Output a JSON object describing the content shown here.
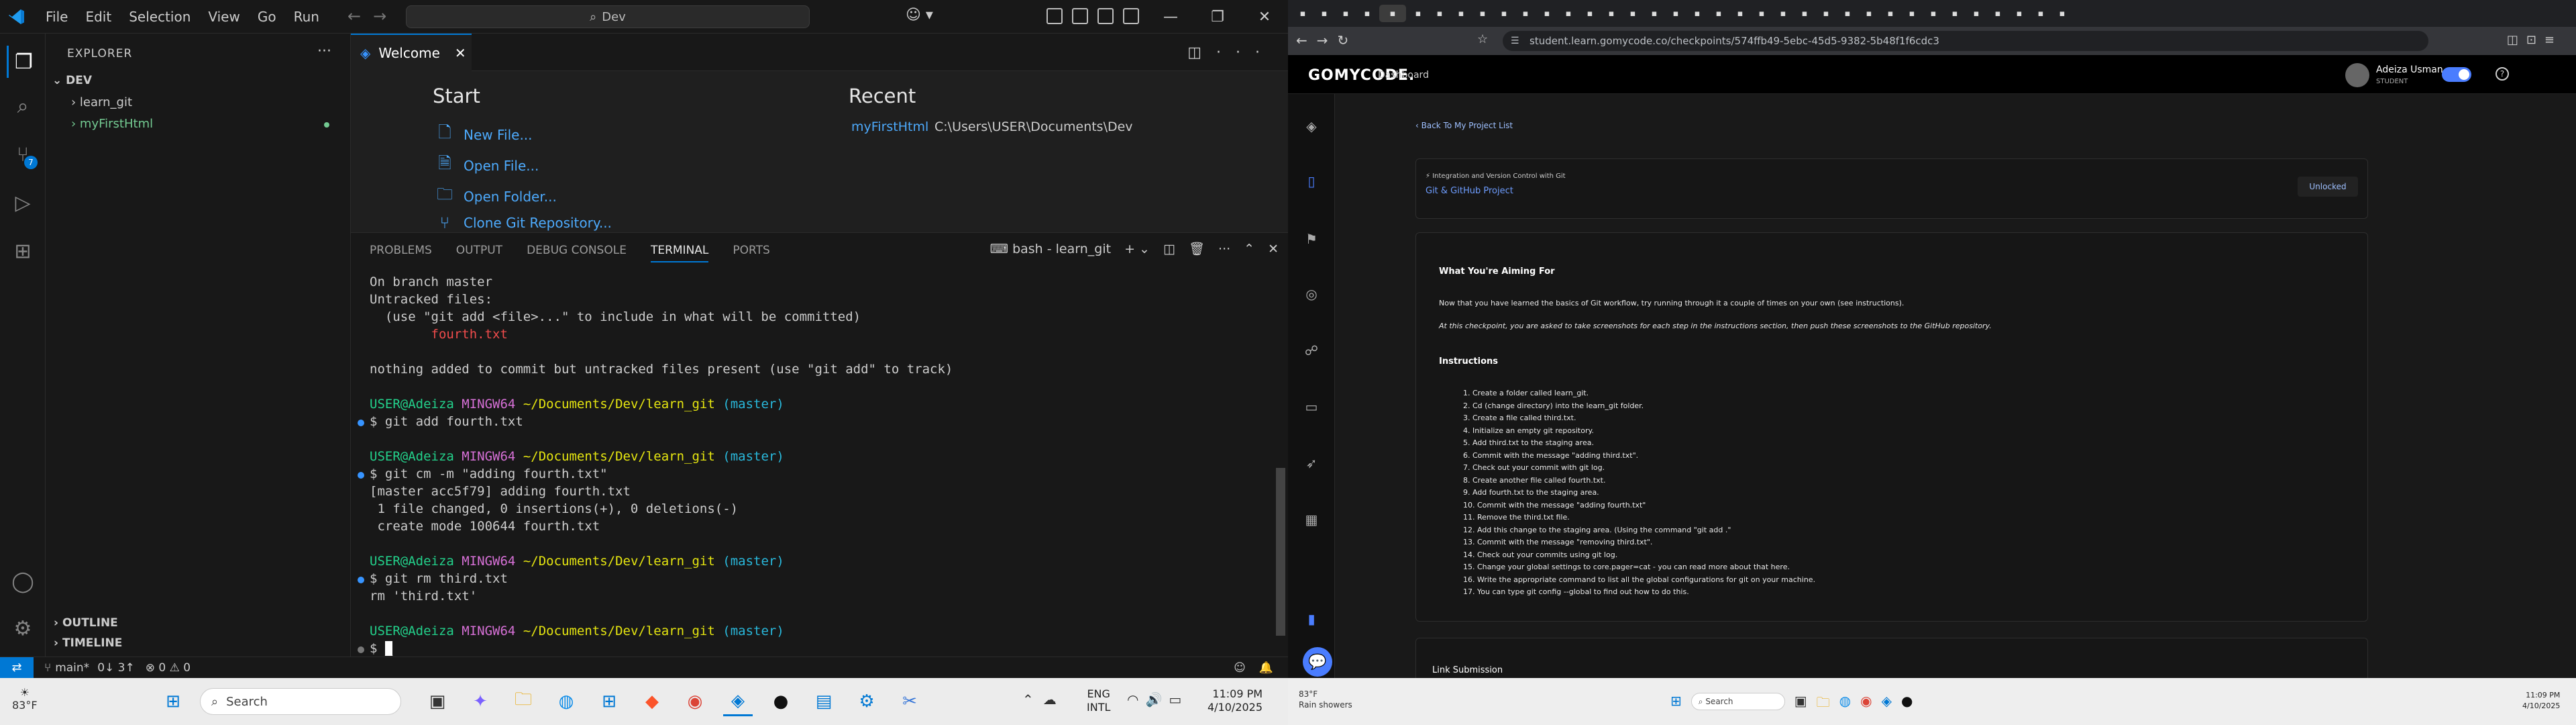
{
  "vscode": {
    "menu": [
      "File",
      "Edit",
      "Selection",
      "View",
      "Go",
      "Run"
    ],
    "search_label": "Dev",
    "explorer_title": "EXPLORER",
    "folder": "DEV",
    "items": [
      "learn_git",
      "myFirstHtml"
    ],
    "outline": "OUTLINE",
    "timeline": "TIMELINE",
    "tab_title": "Welcome",
    "start_title": "Start",
    "start_links": [
      "New File...",
      "Open File...",
      "Open Folder...",
      "Clone Git Repository..."
    ],
    "recent_title": "Recent",
    "recent_name": "myFirstHtml",
    "recent_path": "C:\\Users\\USER\\Documents\\Dev",
    "panel_tabs": [
      "PROBLEMS",
      "OUTPUT",
      "DEBUG CONSOLE",
      "TERMINAL",
      "PORTS"
    ],
    "terminal_name": "bash - learn_git",
    "terminal": {
      "l1": "On branch master",
      "l2": "Untracked files:",
      "l3": "  (use \"git add <file>...\" to include in what will be committed)",
      "l4": "        fourth.txt",
      "l5": "nothing added to commit but untracked files present (use \"git add\" to track)",
      "user": "USER@Adeiza",
      "host": "MINGW64",
      "path": "~/Documents/Dev/learn_git",
      "branch": "(master)",
      "c1": "$ git add fourth.txt",
      "c2": "$ git cm -m \"adding fourth.txt\"",
      "o1": "[master acc5f79] adding fourth.txt",
      "o2": " 1 file changed, 0 insertions(+), 0 deletions(-)",
      "o3": " create mode 100644 fourth.txt",
      "c3": "$ git rm third.txt",
      "o4": "rm 'third.txt'",
      "c4": "$ "
    },
    "status": {
      "branch": "main*",
      "sync": "0↓ 3↑",
      "problems": "⊗ 0 ⚠ 0"
    },
    "badge_count": "7"
  },
  "browser": {
    "url": "student.learn.gomycode.co/checkpoints/574ffb49-5ebc-45d5-9382-5b48f1f6cdc3",
    "brand": "GOMYCODE.",
    "nav_dashboard": "Dashboard",
    "user_name": "Adeiza Usman",
    "user_role": "STUDENT",
    "back_link": "Back To My Project List",
    "course": "Integration and Version Control with Git",
    "project": "Git & GitHub Project",
    "unlocked": "Unlocked",
    "aim_title": "What You're Aiming For",
    "aim_text1": "Now that you have learned the basics of Git workflow, try running through it a couple of times on your own (see instructions).",
    "aim_text2": "At this checkpoint, you are asked to take screenshots for each step in the instructions section, then push these screenshots to the GitHub repository.",
    "instr_title": "Instructions",
    "instructions": [
      "1. Create a folder called learn_git.",
      "2. Cd (change directory) into the learn_git folder.",
      "3. Create a file called third.txt.",
      "4. Initialize an empty git repository.",
      "5. Add third.txt to the staging area.",
      "6. Commit with the message \"adding third.txt\".",
      "7. Check out your commit with git log.",
      "8. Create another file called fourth.txt.",
      "9. Add fourth.txt to the staging area.",
      "10. Commit with the message \"adding fourth.txt\"",
      "11. Remove the third.txt file.",
      "12. Add this change to the staging area. (Using the command \"git add .\"",
      "13. Commit with the message \"removing third.txt\".",
      "14. Check out your commits using git log.",
      "15. Change your global settings to core.pager=cat - you can read more about that here.",
      "16. Write the appropriate command to list all the global configurations for git on your machine.",
      "17. You can type git config --global to find out how to do this."
    ],
    "link_sub": "Link Submission"
  },
  "taskbar": {
    "temp": "83°F",
    "search": "Search",
    "lang1": "ENG",
    "lang2": "INTL",
    "time": "11:09 PM",
    "date": "4/10/2025",
    "weather2": "Rain showers",
    "time_small": "11:09 PM",
    "date_small": "4/10/2025"
  }
}
